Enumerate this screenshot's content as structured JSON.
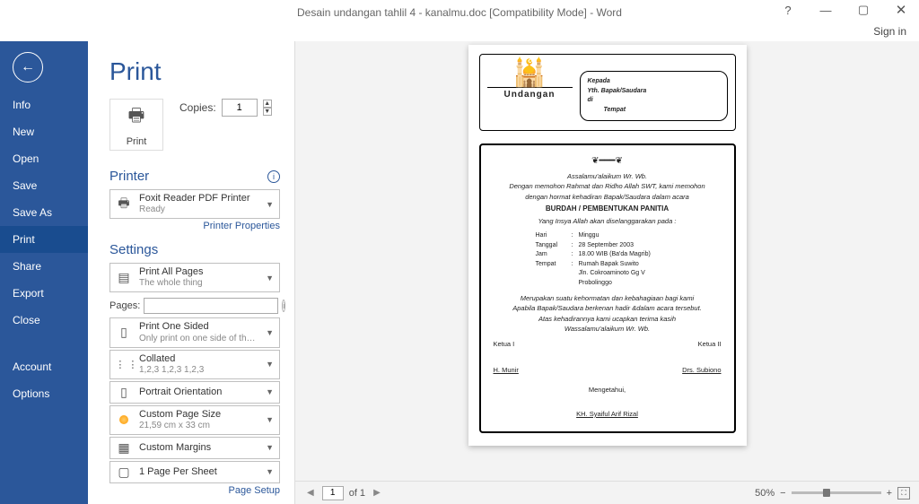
{
  "window": {
    "title": "Desain undangan tahlil 4 - kanalmu.doc [Compatibility Mode] - Word",
    "signin": "Sign in"
  },
  "sidebar": {
    "items": [
      "Info",
      "New",
      "Open",
      "Save",
      "Save As",
      "Print",
      "Share",
      "Export",
      "Close"
    ],
    "items_bottom": [
      "Account",
      "Options"
    ],
    "active": "Print"
  },
  "print": {
    "heading": "Print",
    "print_button": "Print",
    "copies_label": "Copies:",
    "copies_value": "1",
    "printer_heading": "Printer",
    "printer_name": "Foxit Reader PDF Printer",
    "printer_status": "Ready",
    "printer_properties": "Printer Properties",
    "settings_heading": "Settings",
    "setting1_main": "Print All Pages",
    "setting1_sub": "The whole thing",
    "pages_label": "Pages:",
    "setting2_main": "Print One Sided",
    "setting2_sub": "Only print on one side of th…",
    "setting3_main": "Collated",
    "setting3_sub": "1,2,3    1,2,3    1,2,3",
    "setting4_main": "Portrait Orientation",
    "setting5_main": "Custom Page Size",
    "setting5_sub": "21,59 cm x 33 cm",
    "setting6_main": "Custom Margins",
    "setting7_main": "1 Page Per Sheet",
    "page_setup": "Page Setup"
  },
  "preview": {
    "current_page": "1",
    "total_pages": "of 1",
    "zoom": "50%",
    "doc": {
      "undangan": "Undangan",
      "kepada": "Kepada",
      "yth": "Yth. Bapak/Saudara",
      "di": "di",
      "tempat": "Tempat",
      "salam": "Assalamu'alaikum Wr. Wb.",
      "p1": "Dengan memohon Rahmat dan Ridho Allah SWT, kami memohon",
      "p2": "dengan hormat kehadiran Bapak/Saudara dalam acara",
      "event_title": "BURDAH / PEMBENTUKAN PANITIA",
      "p3": "Yang Insya Allah akan diselanggarakan pada :",
      "hari_k": "Hari",
      "hari_v": "Minggu",
      "tgl_k": "Tanggal",
      "tgl_v": "28 September  2003",
      "jam_k": "Jam",
      "jam_v": "18.00 WIB (Ba'da Magrib)",
      "tmp_k": "Tempat",
      "tmp_v": "Rumah Bapak Suwito",
      "addr": "Jln. Cokroaminoto Gg V",
      "city": "Probolinggo",
      "p4": "Merupakan suatu kehormatan dan kebahagiaan bagi kami",
      "p5": "Apabila Bapak/Saudara berkenan hadir &dalam acara tersebut.",
      "p6": "Atas kehadirannya kami ucapkan terima kasih",
      "closing": "Wassalamu'alaikum Wr. Wb.",
      "ketua1": "Ketua I",
      "ketua2": "Ketua II",
      "name1": "H. Munir",
      "name2": "Drs. Subiono",
      "mengetahui": "Mengetahui,",
      "kh": "KH. Syaiful Arif Rizal"
    }
  }
}
